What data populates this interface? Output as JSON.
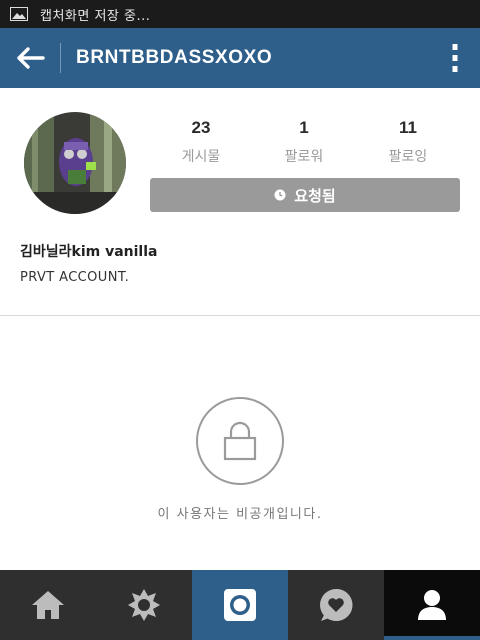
{
  "status_bar": {
    "notification_text": "캡처화면 저장 중..."
  },
  "header": {
    "username": "BRNTBBDASSXOXO"
  },
  "profile": {
    "stats": [
      {
        "value": "23",
        "label": "게시물"
      },
      {
        "value": "1",
        "label": "팔로워"
      },
      {
        "value": "11",
        "label": "팔로잉"
      }
    ],
    "request_button_label": "요청됨",
    "full_name": "김바닐라kim vanilla",
    "bio": "PRVT ACCOUNT."
  },
  "private_notice": "이 사용자는 비공개입니다.",
  "bottom_nav": {
    "items": [
      "home-icon",
      "explore-icon",
      "camera-icon",
      "activity-icon",
      "profile-icon"
    ]
  },
  "colors": {
    "accent": "#2e5e8a",
    "nav_bg": "#2f2f2f",
    "button_gray": "#9a9a9a"
  }
}
